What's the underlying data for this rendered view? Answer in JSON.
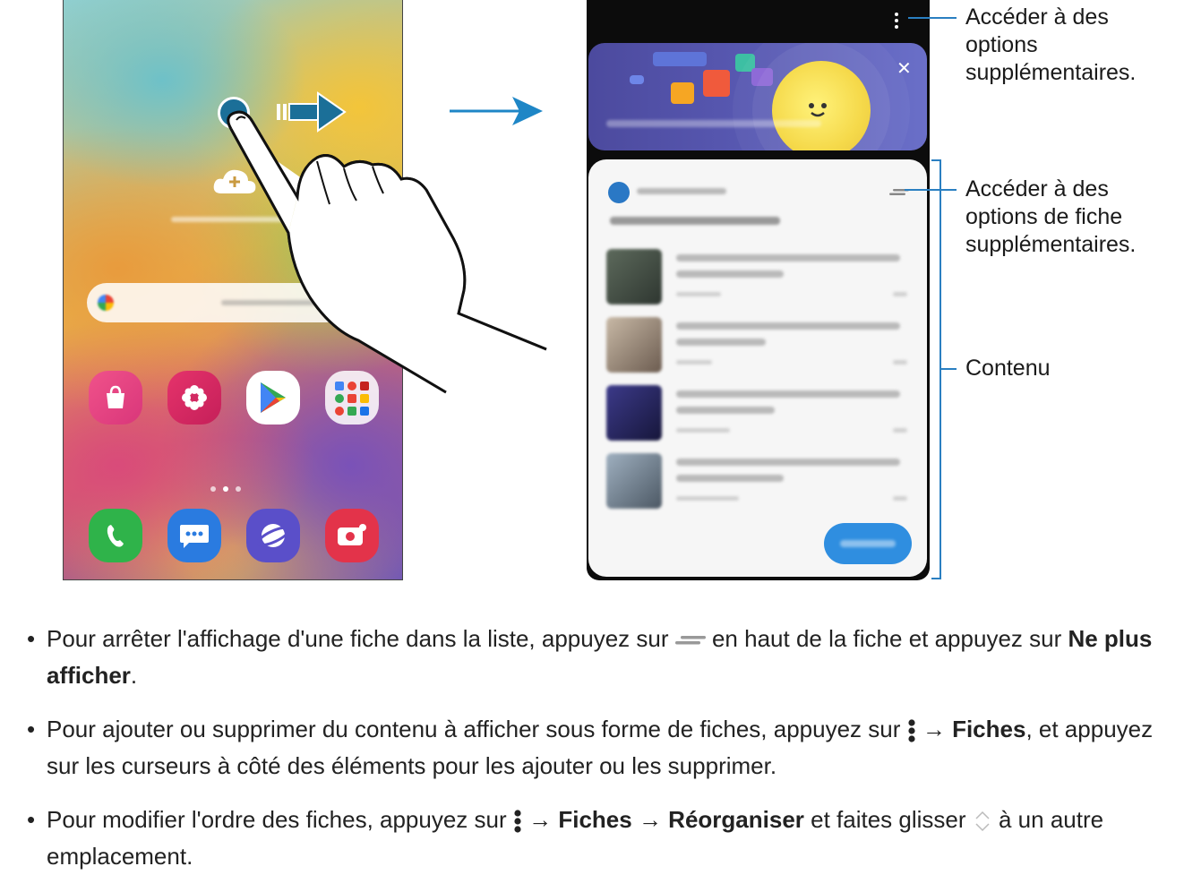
{
  "callouts": {
    "more_options": "Accéder à des\noptions\nsupplémentaires.",
    "card_options": "Accéder à des\noptions de fiche\nsupplémentaires.",
    "content": "Contenu"
  },
  "bullets": [
    {
      "pre": "Pour arrêter l'affichage d'une fiche dans la liste, appuyez sur ",
      "mid": " en haut de la fiche et appuyez sur ",
      "bold": "Ne plus afficher",
      "post": "."
    },
    {
      "pre": "Pour ajouter ou supprimer du contenu à afficher sous forme de fiches, appuyez sur ",
      "arrow": " → ",
      "bold": "Fiches",
      "post": ", et appuyez sur les curseurs à côté des éléments pour les ajouter ou les supprimer."
    },
    {
      "pre": "Pour modifier l'ordre des fiches, appuyez sur ",
      "arrow1": " → ",
      "bold1": "Fiches",
      "arrow2": " → ",
      "bold2": "Réorganiser",
      "mid": " et faites glisser ",
      "post": " à un autre emplacement."
    }
  ],
  "colors": {
    "leader": "#2a7fc1",
    "accent": "#2f8ee0"
  }
}
